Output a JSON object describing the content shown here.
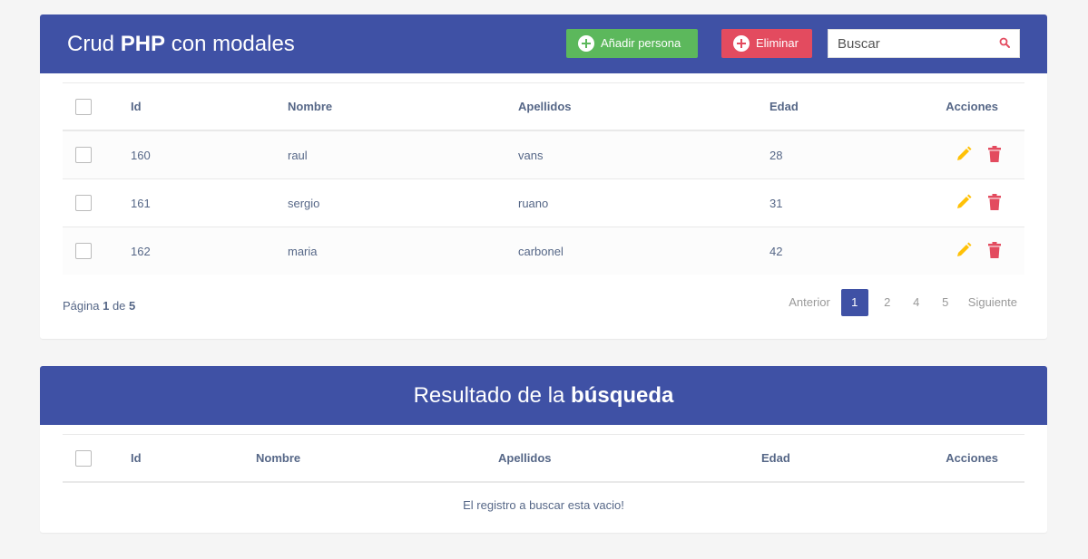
{
  "crud": {
    "title_prefix": "Crud ",
    "title_bold": "PHP",
    "title_suffix": " con modales",
    "add_label": "Añadir persona",
    "delete_label": "Eliminar",
    "search_placeholder": "Buscar",
    "columns": [
      "Id",
      "Nombre",
      "Apellidos",
      "Edad",
      "Acciones"
    ],
    "rows": [
      {
        "id": "160",
        "nombre": "raul",
        "apellidos": "vans",
        "edad": "28"
      },
      {
        "id": "161",
        "nombre": "sergio",
        "apellidos": "ruano",
        "edad": "31"
      },
      {
        "id": "162",
        "nombre": "maria",
        "apellidos": "carbonel",
        "edad": "42"
      }
    ],
    "footer": {
      "pagina": "Página ",
      "current": "1",
      "de": " de ",
      "total": "5"
    },
    "pager": {
      "prev": "Anterior",
      "pages": [
        "1",
        "2",
        "4",
        "5"
      ],
      "next": "Siguiente"
    }
  },
  "results": {
    "title_prefix": "Resultado de la ",
    "title_bold": "búsqueda",
    "columns": [
      "Id",
      "Nombre",
      "Apellidos",
      "Edad",
      "Acciones"
    ],
    "empty_message": "El registro a buscar esta vacio!"
  },
  "colors": {
    "header": "#3f51a5",
    "add": "#5cb85c",
    "delete": "#e34b5f",
    "edit_icon": "#ffc107",
    "delete_icon": "#e34b5f"
  },
  "icons": {
    "search": "search-icon",
    "add": "plus-circle-icon",
    "delete": "plus-circle-icon",
    "edit": "pencil-icon",
    "trash": "trash-icon"
  }
}
